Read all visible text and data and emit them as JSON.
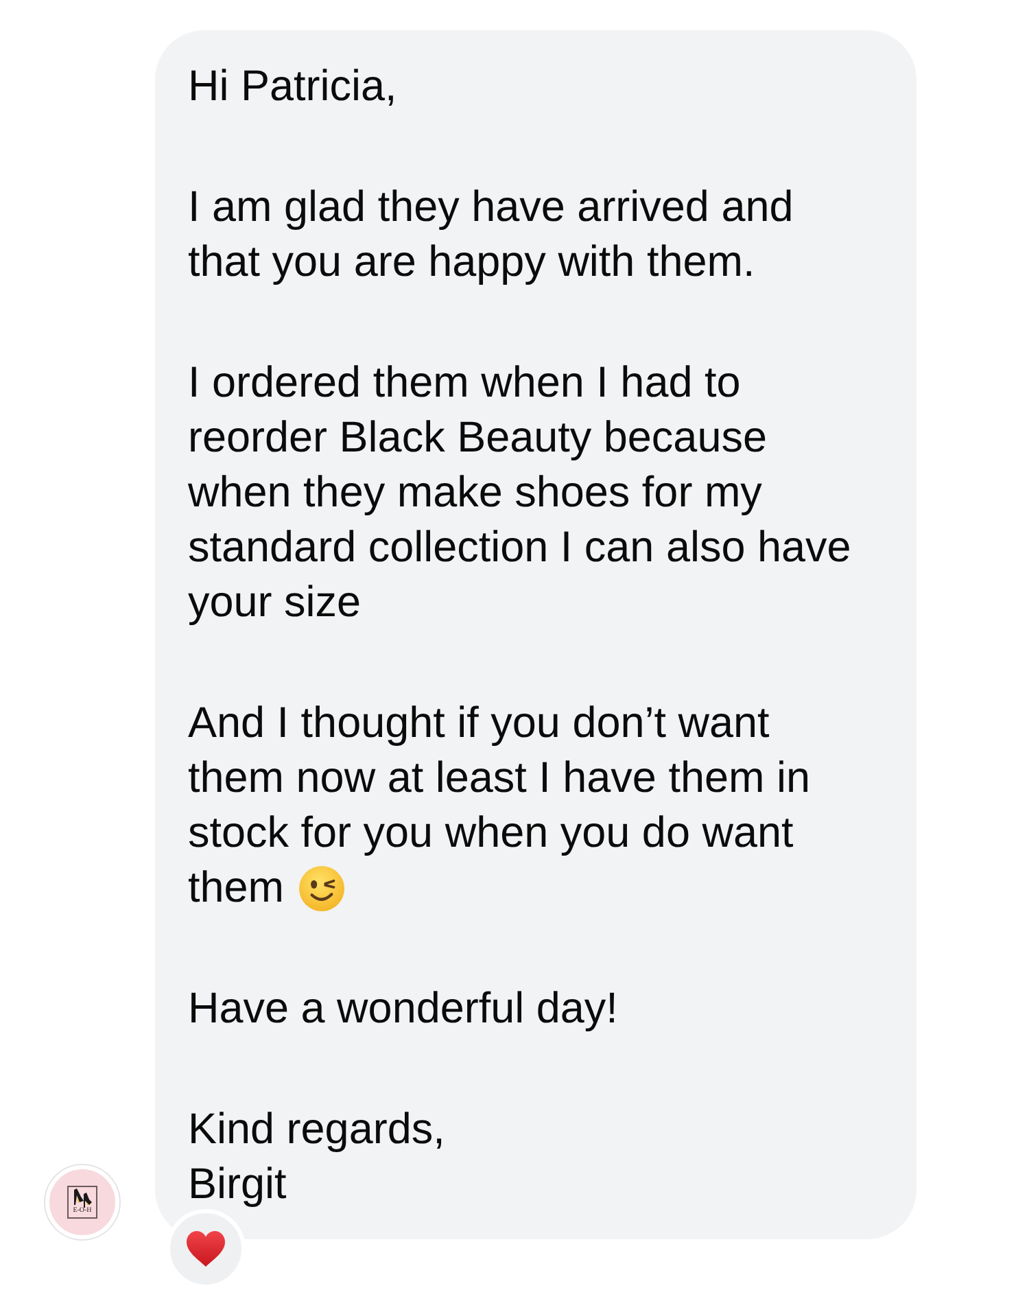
{
  "sender": {
    "avatar": {
      "logo_text": "E-O-H"
    }
  },
  "message": {
    "paragraphs": [
      {
        "text": "Hi Patricia,",
        "emoji": false
      },
      {
        "text": "I am glad they have arrived and\nthat you are happy with them.",
        "emoji": false
      },
      {
        "text": "I ordered them when I had to\nreorder Black Beauty because\nwhen they make shoes for my\nstandard collection I can also have\nyour size",
        "emoji": false
      },
      {
        "text": "And I thought if you don’t want\nthem now at least I have them in\nstock for you when you do want\nthem",
        "emoji": true
      },
      {
        "text": "Have a wonderful day!",
        "emoji": false
      },
      {
        "text": "Kind regards,\nBirgit",
        "emoji": false
      }
    ],
    "reacted": true
  }
}
